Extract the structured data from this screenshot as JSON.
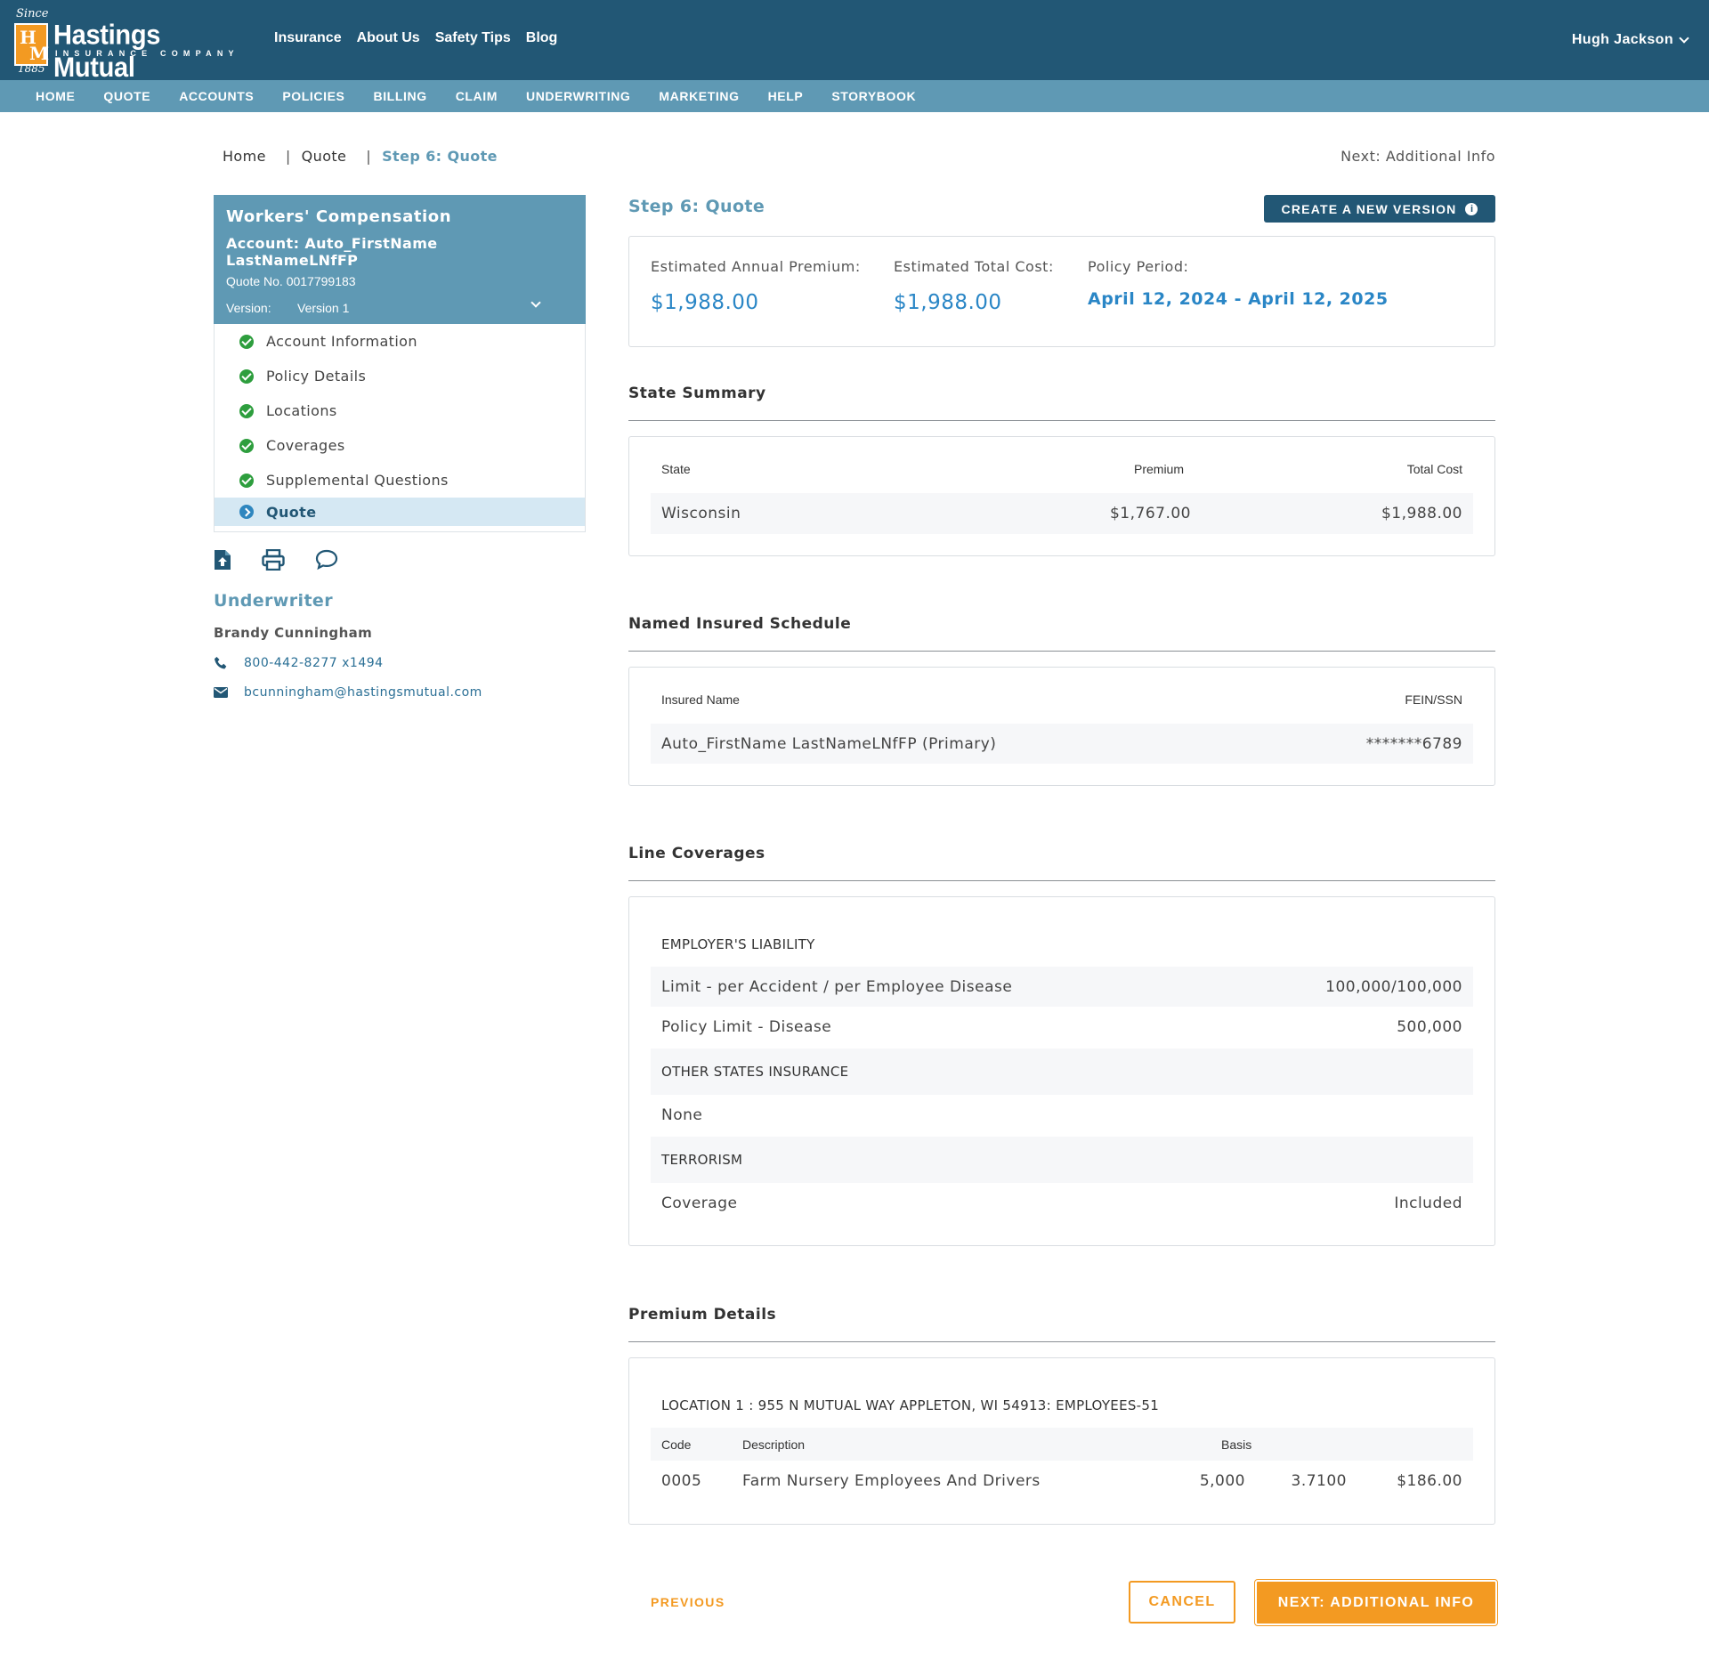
{
  "brand": {
    "since": "Since",
    "year": "1885",
    "name": "Hastings Mutual",
    "subtitle": "INSURANCE COMPANY",
    "monogram_h": "H",
    "monogram_m": "M"
  },
  "topnav": [
    "Insurance",
    "About Us",
    "Safety Tips",
    "Blog"
  ],
  "user": {
    "name": "Hugh Jackson"
  },
  "mainnav": [
    "HOME",
    "QUOTE",
    "ACCOUNTS",
    "POLICIES",
    "BILLING",
    "CLAIM",
    "UNDERWRITING",
    "MARKETING",
    "HELP",
    "STORYBOOK"
  ],
  "breadcrumb": {
    "home": "Home",
    "quote": "Quote",
    "current": "Step 6: Quote",
    "separator": "|"
  },
  "next_link": "Next: Additional Info",
  "sidebar": {
    "title": "Workers' Compensation",
    "account": "Account: Auto_FirstName LastNameLNfFP",
    "quote_no": "Quote No. 0017799183",
    "version_label": "Version:",
    "version_value": "Version 1",
    "items": [
      {
        "label": "Account Information",
        "status": "complete"
      },
      {
        "label": "Policy Details",
        "status": "complete"
      },
      {
        "label": "Locations",
        "status": "complete"
      },
      {
        "label": "Coverages",
        "status": "complete"
      },
      {
        "label": "Supplemental Questions",
        "status": "complete"
      },
      {
        "label": "Quote",
        "status": "current"
      }
    ],
    "tools": [
      "upload-document-icon",
      "print-icon",
      "comment-icon"
    ]
  },
  "underwriter": {
    "title": "Underwriter",
    "name": "Brandy Cunningham",
    "phone": "800-442-8277 x1494",
    "email": "bcunningham@hastingsmutual.com"
  },
  "main": {
    "step_title": "Step 6: Quote",
    "new_version_label": "CREATE A NEW VERSION",
    "summary": {
      "annual_label": "Estimated Annual Premium:",
      "annual_value": "$1,988.00",
      "total_label": "Estimated Total Cost:",
      "total_value": "$1,988.00",
      "period_label": "Policy Period:",
      "period_value": "April 12, 2024 - April 12, 2025"
    },
    "state_summary": {
      "title": "State Summary",
      "headers": {
        "state": "State",
        "premium": "Premium",
        "total": "Total Cost"
      },
      "rows": [
        {
          "state": "Wisconsin",
          "premium": "$1,767.00",
          "total": "$1,988.00"
        }
      ]
    },
    "named_insured": {
      "title": "Named Insured Schedule",
      "headers": {
        "name": "Insured Name",
        "fein": "FEIN/SSN"
      },
      "rows": [
        {
          "name": "Auto_FirstName LastNameLNfFP (Primary)",
          "fein": "*******6789"
        }
      ]
    },
    "line_coverages": {
      "title": "Line Coverages",
      "employers_liability": "EMPLOYER'S LIABILITY",
      "limit_label": "Limit - per Accident / per Employee Disease",
      "limit_value": "100,000/100,000",
      "policy_limit_label": "Policy Limit - Disease",
      "policy_limit_value": "500,000",
      "other_states": "OTHER STATES INSURANCE",
      "other_states_value": "None",
      "terrorism": "TERRORISM",
      "coverage_label": "Coverage",
      "coverage_value": "Included"
    },
    "premium_details": {
      "title": "Premium Details",
      "location": "LOCATION 1 : 955 N MUTUAL WAY APPLETON, WI 54913: EMPLOYEES-51",
      "headers": {
        "code": "Code",
        "description": "Description",
        "basis": "Basis"
      },
      "rows": [
        {
          "code": "0005",
          "description": "Farm Nursery Employees And Drivers",
          "basis": "5,000",
          "rate": "3.7100",
          "premium": "$186.00"
        }
      ]
    }
  },
  "actions": {
    "previous": "PREVIOUS",
    "cancel": "CANCEL",
    "next": "NEXT: ADDITIONAL INFO"
  },
  "colors": {
    "header": "#225775",
    "nav": "#5f99b4",
    "accent": "#2a86c6",
    "orange": "#f39a22",
    "success": "#2e9e3e"
  }
}
